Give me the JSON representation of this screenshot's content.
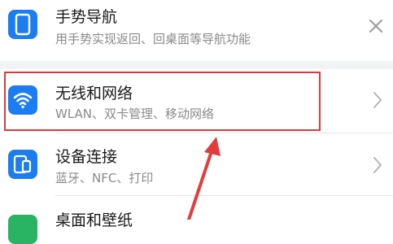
{
  "rows": [
    {
      "title": "手势导航",
      "subtitle": "用手势实现返回、回桌面等导航功能",
      "icon": "phone-icon",
      "action_icon": "close-icon"
    },
    {
      "title": "无线和网络",
      "subtitle": "WLAN、双卡管理、移动网络",
      "icon": "wifi-icon",
      "action_icon": "chevron-right-icon"
    },
    {
      "title": "设备连接",
      "subtitle": "蓝牙、NFC、打印",
      "icon": "device-connection-icon",
      "action_icon": "chevron-right-icon"
    },
    {
      "title": "桌面和壁纸",
      "icon": "wallpaper-icon"
    }
  ],
  "colors": {
    "accent_blue": "#1c7cf2",
    "highlight_red": "#d93a3a",
    "title_text": "#1a1a1a",
    "subtitle_text": "#8a8a8a",
    "section_gap": "#f1f3f5"
  }
}
